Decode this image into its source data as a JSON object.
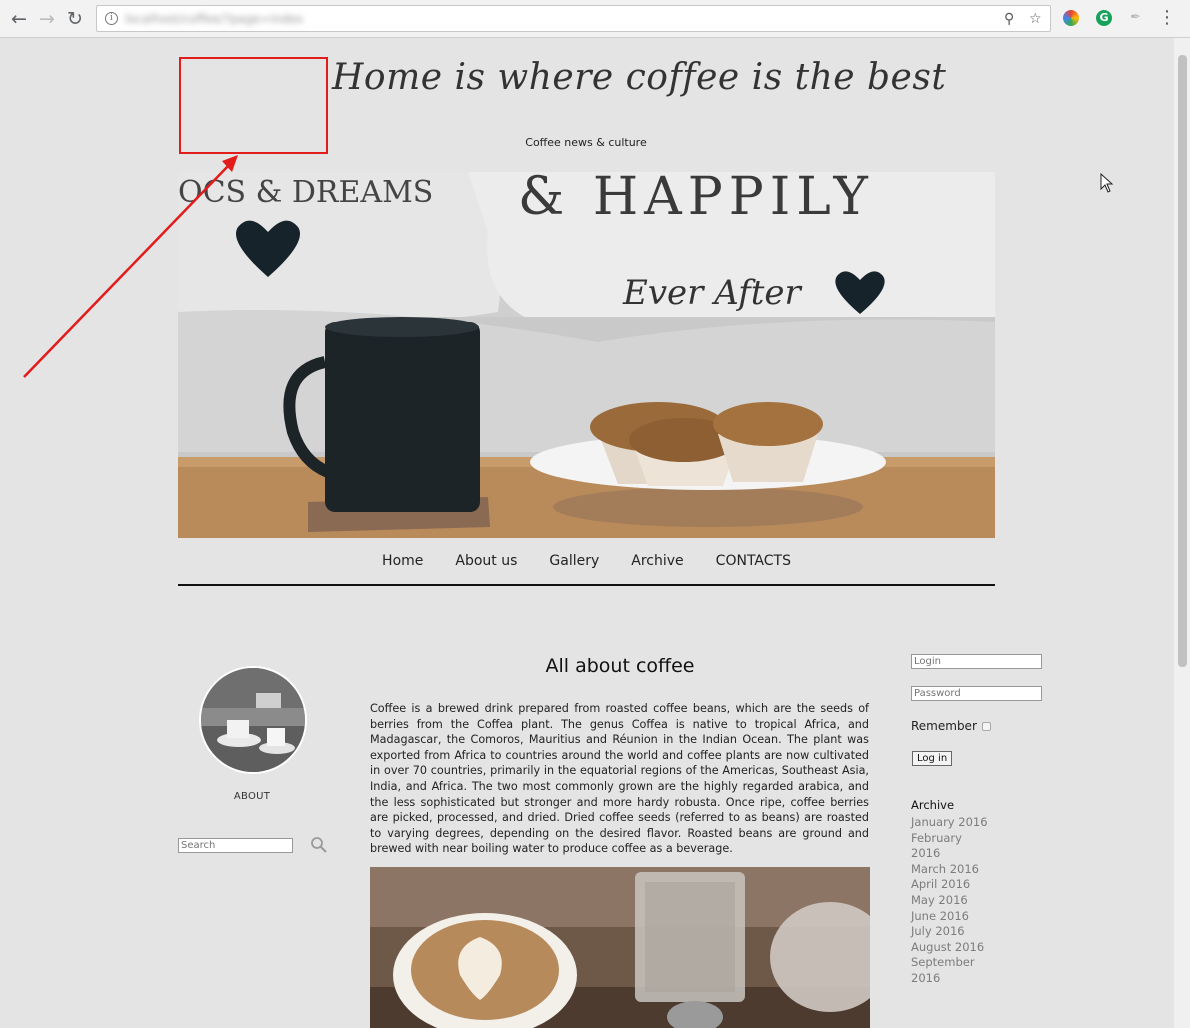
{
  "browser": {
    "url": "localhost/coffee/?page=index",
    "nav_icons": [
      "back-arrow-icon",
      "forward-arrow-icon",
      "reload-icon"
    ],
    "omnibox_icons": [
      "zoom-icon",
      "star-icon"
    ],
    "extensions": [
      "extension-color-icon",
      "grammarly-icon",
      "pin-icon"
    ],
    "menu": "⋮"
  },
  "site": {
    "title": "Home is where coffee is the best",
    "subtitle": "Coffee news & culture"
  },
  "hero_image": {
    "texts": [
      "OCS & DREAMS",
      "& HAPPILY",
      "Ever After"
    ]
  },
  "nav": {
    "items": [
      "Home",
      "About us",
      "Gallery",
      "Archive",
      "CONTACTS"
    ]
  },
  "left": {
    "about_label": "ABOUT",
    "search_placeholder": "Search"
  },
  "article": {
    "title": "All about coffee",
    "body": "Coffee is a brewed drink prepared from roasted coffee beans, which are the seeds of berries from the Coffea plant. The genus Coffea is native to tropical Africa, and Madagascar, the Comoros, Mauritius and Réunion in the Indian Ocean. The plant was exported from Africa to countries around the world and coffee plants are now cultivated in over 70 countries, primarily in the equatorial regions of the Americas, Southeast Asia, India, and Africa. The two most commonly grown are the highly regarded arabica, and the less sophisticated but stronger and more hardy robusta. Once ripe, coffee berries are picked, processed, and dried. Dried coffee seeds (referred to as beans) are roasted to varying degrees, depending on the desired flavor. Roasted beans are ground and brewed with near boiling water to produce coffee as a beverage."
  },
  "login": {
    "login_placeholder": "Login",
    "password_placeholder": "Password",
    "remember_label": "Remember",
    "button_label": "Log in"
  },
  "archive": {
    "heading": "Archive",
    "months": [
      "January 2016",
      "February 2016",
      "March 2016",
      "April 2016",
      "May 2016",
      "June 2016",
      "July 2016",
      "August 2016",
      "September 2016"
    ]
  },
  "annotation": {
    "color": "#e21b1b"
  }
}
